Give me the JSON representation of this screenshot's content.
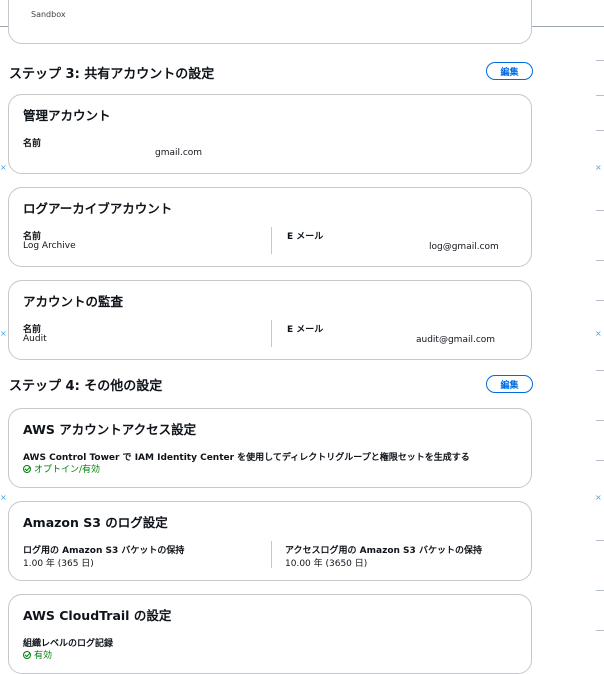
{
  "top_partial": {
    "text": "Sandbox"
  },
  "step3": {
    "heading": "ステップ 3: 共有アカウントの設定",
    "edit_label": "編集",
    "management": {
      "title": "管理アカウント",
      "name_label": "名前",
      "name_value": "",
      "email_value": "gmail.com"
    },
    "log_archive": {
      "title": "ログアーカイブアカウント",
      "name_label": "名前",
      "name_value": "Log Archive",
      "email_label": "E メール",
      "email_value": "log@gmail.com"
    },
    "audit": {
      "title": "アカウントの監査",
      "name_label": "名前",
      "name_value": "Audit",
      "email_label": "E メール",
      "email_value": "audit@gmail.com"
    }
  },
  "step4": {
    "heading": "ステップ 4: その他の設定",
    "edit_label": "編集",
    "access": {
      "title": "AWS アカウントアクセス設定",
      "label": "AWS Control Tower で IAM Identity Center を使用してディレクトリグループと権限セットを生成する",
      "status": "オプトイン/有効"
    },
    "s3": {
      "title": "Amazon S3 のログ設定",
      "log_label": "ログ用の Amazon S3 バケットの保持",
      "log_value": "1.00 年 (365 日)",
      "access_label": "アクセスログ用の Amazon S3 バケットの保持",
      "access_value": "10.00 年 (3650 日)"
    },
    "cloudtrail": {
      "title": "AWS CloudTrail の設定",
      "label": "組織レベルのログ記録",
      "status": "有効"
    }
  },
  "colors": {
    "accent": "#006ce0",
    "success": "#037f0c",
    "border": "#c6c6cd"
  }
}
